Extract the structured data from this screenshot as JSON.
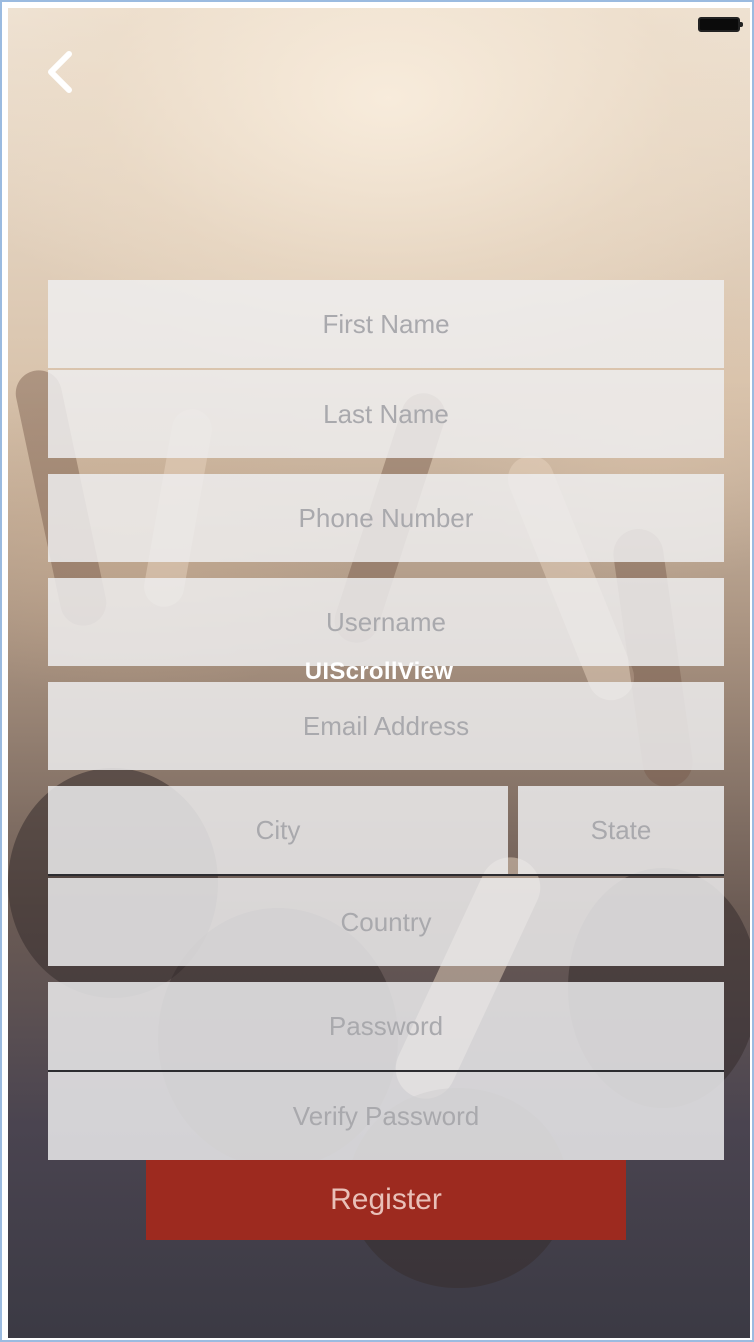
{
  "status_bar": {
    "battery_icon": "battery-icon"
  },
  "nav": {
    "back_icon": "chevron-left-icon"
  },
  "overlay_label": "UIScrollView",
  "form": {
    "first_name": "First Name",
    "last_name": "Last Name",
    "phone": "Phone Number",
    "username": "Username",
    "email": "Email Address",
    "city": "City",
    "state": "State",
    "country": "Country",
    "password": "Password",
    "verify_password": "Verify Password"
  },
  "register_label": "Register",
  "colors": {
    "register": "#9d2a1f",
    "field": "#eeeef0",
    "placeholder": "#a9a9ad"
  }
}
